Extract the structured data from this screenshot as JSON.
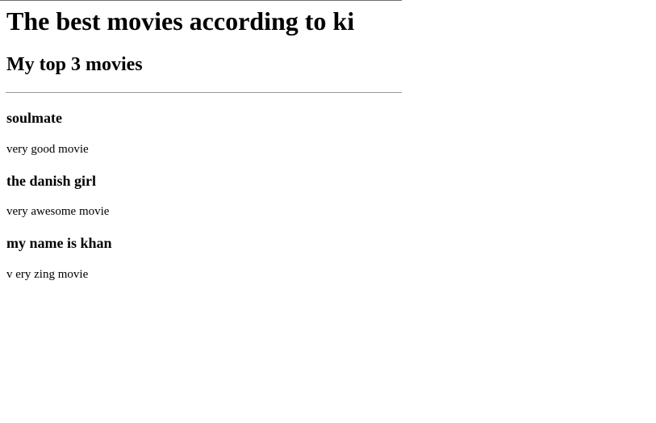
{
  "page": {
    "title": "The best movies according to ki",
    "subtitle": "My top 3 movies"
  },
  "movies": [
    {
      "name": "soulmate",
      "description": "very good movie"
    },
    {
      "name": "the danish girl",
      "description": "very awesome movie"
    },
    {
      "name": "my name is khan",
      "description": "v ery zing movie"
    }
  ]
}
